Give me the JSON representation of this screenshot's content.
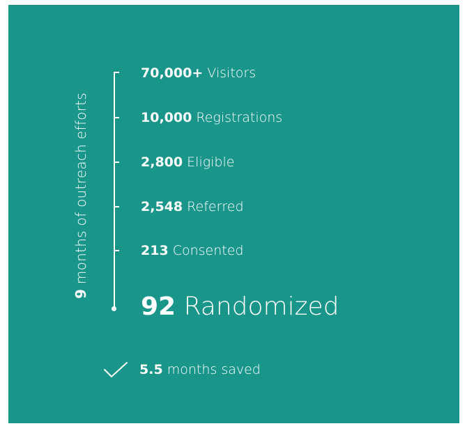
{
  "colors": {
    "panel_background": "#1a958a",
    "text": "#ffffff"
  },
  "duration": {
    "value": "9",
    "label": "months of outreach efforts"
  },
  "funnel": {
    "steps": [
      {
        "value": "70,000+",
        "label": "Visitors"
      },
      {
        "value": "10,000",
        "label": "Registrations"
      },
      {
        "value": "2,800",
        "label": "Eligible"
      },
      {
        "value": "2,548",
        "label": "Referred"
      },
      {
        "value": "213",
        "label": "Consented"
      }
    ],
    "final": {
      "value": "92",
      "label": "Randomized"
    }
  },
  "savings": {
    "icon": "checkmark-icon",
    "value": "5.5",
    "label": "months saved"
  }
}
